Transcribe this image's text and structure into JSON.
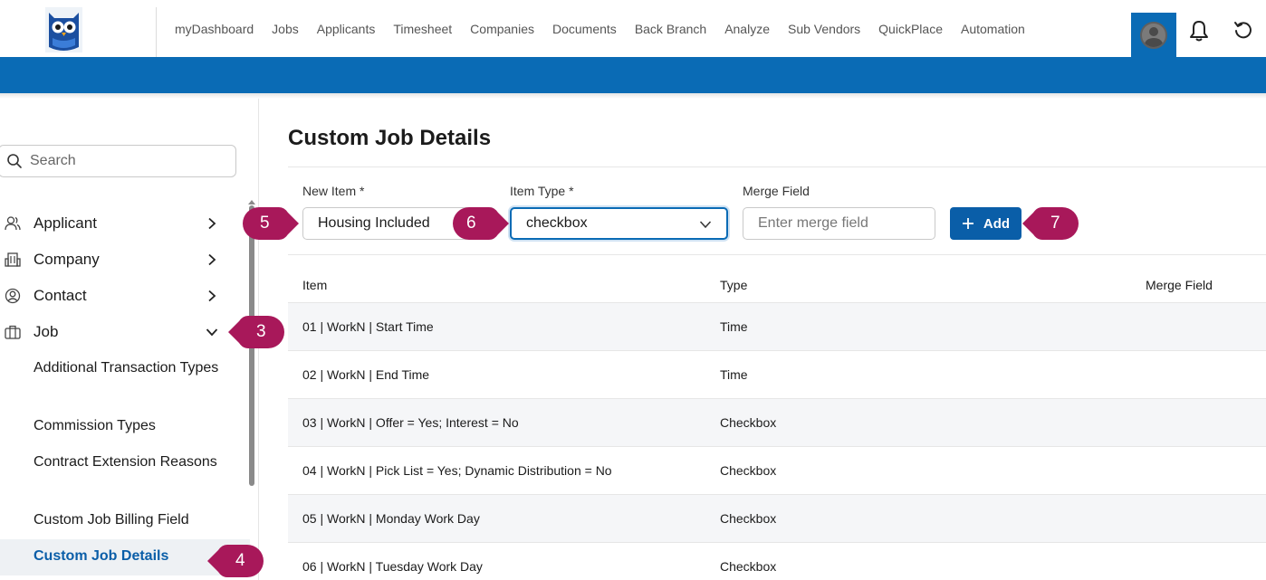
{
  "header": {
    "nav": [
      "myDashboard",
      "Jobs",
      "Applicants",
      "Timesheet",
      "Companies",
      "Documents",
      "Back Branch",
      "Analyze",
      "Sub Vendors",
      "QuickPlace",
      "Automation"
    ],
    "icons": [
      "owl-logo",
      "avatar-icon",
      "bell-icon",
      "refresh-icon"
    ],
    "accent": "#0a6bb5"
  },
  "sidebar": {
    "search_placeholder": "Search",
    "items": [
      {
        "label": "Applicant",
        "icon": "person-icon",
        "expanded": false
      },
      {
        "label": "Company",
        "icon": "building-icon",
        "expanded": false
      },
      {
        "label": "Contact",
        "icon": "contact-icon",
        "expanded": false
      },
      {
        "label": "Job",
        "icon": "briefcase-icon",
        "expanded": true
      }
    ],
    "job_subitems": [
      "Additional Transaction Types",
      "Commission Types",
      "Contract Extension Reasons",
      "Custom Job Billing Field",
      "Custom Job Details"
    ],
    "active_subitem": "Custom Job Details"
  },
  "main": {
    "title": "Custom Job Details",
    "form": {
      "new_item_label": "New Item *",
      "new_item_value": "Housing Included",
      "item_type_label": "Item Type *",
      "item_type_value": "checkbox",
      "merge_field_label": "Merge Field",
      "merge_field_placeholder": "Enter merge field",
      "add_label": "Add"
    },
    "table": {
      "headers": [
        "Item",
        "Type",
        "Merge Field"
      ],
      "rows": [
        {
          "item": "01 | WorkN | Start Time",
          "type": "Time"
        },
        {
          "item": "02 | WorkN | End Time",
          "type": "Time"
        },
        {
          "item": "03 | WorkN | Offer = Yes; Interest = No",
          "type": "Checkbox"
        },
        {
          "item": "04 | WorkN | Pick List = Yes; Dynamic Distribution = No",
          "type": "Checkbox"
        },
        {
          "item": "05 | WorkN | Monday Work Day",
          "type": "Checkbox"
        },
        {
          "item": "06 | WorkN | Tuesday Work Day",
          "type": "Checkbox"
        }
      ]
    }
  },
  "callouts": [
    "3",
    "4",
    "5",
    "6",
    "7"
  ],
  "callout_color": "#a8185a"
}
